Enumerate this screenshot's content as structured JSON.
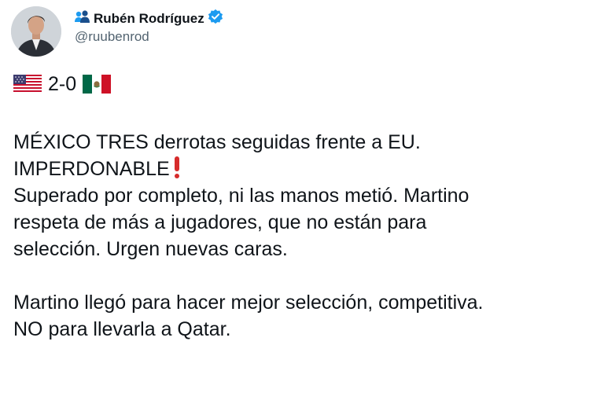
{
  "author": {
    "display_name": "Rubén Rodríguez",
    "handle": "@ruubenrod",
    "verified": true,
    "verified_color": "#1d9bf0"
  },
  "score": {
    "home_flag": "us-flag",
    "result": "2-0",
    "away_flag": "mexico-flag"
  },
  "body": {
    "p1_main": "MÉXICO TRES derrotas seguidas frente a EU.\nIMPERDONABLE",
    "p1_emoji": "red-exclamation",
    "p2": "Superado por completo, ni las manos metió. Martino\nrespeta de más a jugadores, que no están para\nselección. Urgen nuevas caras.",
    "p3": "Martino llegó para hacer mejor selección, competitiva.\nNO para llevarla a Qatar."
  }
}
